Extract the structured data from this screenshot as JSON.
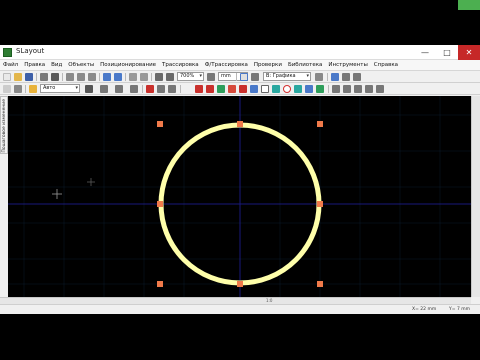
{
  "window": {
    "title": "SLayout",
    "minimize": "—",
    "maximize": "□",
    "close": "✕"
  },
  "menu": [
    "Файл",
    "Правка",
    "Вид",
    "Объекты",
    "Позиционирование",
    "Трассировка",
    "Ф/Трассировка",
    "Проверки",
    "Библиотека",
    "Инструменты",
    "Справка"
  ],
  "toolbar": {
    "zoom": "700%",
    "unit": "mm",
    "layer": "В: Графика",
    "sub_layer": "Авто"
  },
  "sidebar_tab": "Пошаговое изменение",
  "statusbar": {
    "x_readout": "X= 22 mm",
    "y_readout": "Y= 7 mm"
  },
  "hscroll_label": "1:0",
  "colors": {
    "circle": "#ffffaa",
    "handle": "#f07a4a",
    "grid_line": "#0b1b2a",
    "axis": "#19197a",
    "accent_close": "#c62828"
  },
  "icons": [
    "app-icon",
    "new-file-icon",
    "open-folder-icon",
    "save-icon",
    "print-icon",
    "undo-icon",
    "redo-icon",
    "zoom-in-icon",
    "zoom-out-icon",
    "circle-tool-icon"
  ]
}
